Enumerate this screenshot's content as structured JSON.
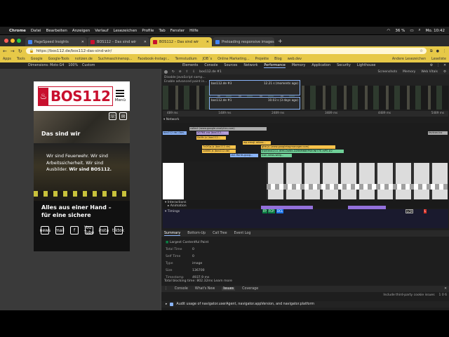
{
  "menubar": {
    "app": "Chrome",
    "items": [
      "Datei",
      "Bearbeiten",
      "Anzeigen",
      "Verlauf",
      "Lesezeichen",
      "Profile",
      "Tab",
      "Fenster",
      "Hilfe"
    ],
    "battery": "36 %",
    "clock": "Mo. 10:42"
  },
  "tabs": [
    {
      "title": "PageSpeed Insights",
      "color": "#4285f4"
    },
    {
      "title": "BOS112 – Das sind wir",
      "color": "#c8102e"
    },
    {
      "title": "BOS112 – Das sind wir",
      "color": "#c8102e"
    },
    {
      "title": "Preloading responsive images",
      "color": "#4285f4"
    }
  ],
  "address": {
    "url": "https://bos112.de/bos112-das-sind-wir/"
  },
  "bookmarks": [
    "Apps",
    "Tools",
    "Google",
    "Google-Tools",
    "notizen.de",
    "Suchmaschinenop...",
    "Facebook-Instagr...",
    "Termstudium",
    "JOB´s",
    "Online Marketing...",
    "Projekte",
    "Blog",
    "web.dev"
  ],
  "bookmarks_right": [
    "Andere Lesezeichen",
    "Leseliste"
  ],
  "devbar": {
    "dimensions": "Dimensions: Moto G4",
    "zoom": "100%",
    "throttle": "Custom",
    "tabs": [
      "Elements",
      "Console",
      "Sources",
      "Network",
      "Performance",
      "Memory",
      "Application",
      "Security",
      "Lighthouse"
    ],
    "active_tab": "Performance"
  },
  "site": {
    "logo": "BOS112",
    "menu_label": "Menü",
    "hero_title": "Das sind wir",
    "intro_plain": "Wir sind Feuerwehr. Wir sind Arbeitssicherheit. Wir sind Ausbilder.",
    "intro_bold": "Wir sind BOS112.",
    "section_title": "Alles aus einer Hand – für eine sichere",
    "social": [
      "news",
      "mail",
      "f",
      "You Tube",
      "insta",
      "tiktok"
    ]
  },
  "perf": {
    "toolbar_host": "bos112.de #1",
    "screenshots": "Screenshots",
    "memory": "Memory",
    "webvitals": "Web Vitals",
    "settings": [
      "Disable JavaScript samp...",
      "Enable advanced paint in..."
    ],
    "popups": [
      {
        "label": "bos112.de #3",
        "meta": "12.21 s (moments ago)"
      },
      {
        "label": "bos112.de #1",
        "meta": "10.03 s (3 days ago)"
      }
    ],
    "ruler": [
      "489 ms",
      "1489 ms",
      "2489 ms",
      "3489 ms",
      "4489 ms",
      "5489 ms"
    ],
    "network_label": "Network",
    "requests": [
      {
        "label": "collect (www.google-analytics.com)",
        "color": "#aaa"
      },
      {
        "label": "bos112.de/ (bos...",
        "color": "#8ab4f8"
      },
      {
        "label": "20764-css (bos112...",
        "color": "#b39ddb"
      },
      {
        "label": "0a4fc.js (bos112...",
        "color": "#f6c34b"
      },
      {
        "label": "wp-emoji-releas...",
        "color": "#f6c34b"
      },
      {
        "label": "gtm.js (www.googletagmanager.com)",
        "color": "#f6c34b"
      },
      {
        "label": "7c0f1a.js (bos112.de)",
        "color": "#f6c34b"
      },
      {
        "label": "trontend2/11 JK96-DaWk-DZ66M68EPSE0NI77E-mP0.#2",
        "color": "#6fcf97"
      },
      {
        "label": "14650.js (bos112.de)",
        "color": "#f6c34b"
      },
      {
        "label": "cb2.ffonts.goog...",
        "color": "#8ab4f8"
      },
      {
        "label": "icon-news-widg...",
        "color": "#6fcf97"
      },
      {
        "label": "favicon.ico",
        "color": "#aaa"
      }
    ],
    "interactions_label": "Interactions",
    "animation_label": "Animation",
    "timings_label": "Timings",
    "timing_tags": [
      "FP",
      "FCP",
      "DCL",
      "LCP",
      "L"
    ],
    "bottom_tabs": [
      "Summary",
      "Bottom-Up",
      "Call Tree",
      "Event Log"
    ],
    "summary": {
      "title": "Largest Contentful Paint",
      "rows": [
        {
          "k": "Total Time",
          "v": "0"
        },
        {
          "k": "Self Time",
          "v": "0"
        },
        {
          "k": "Type",
          "v": "image"
        },
        {
          "k": "Size",
          "v": "136700"
        },
        {
          "k": "Timestamp",
          "v": "4937.9 ms"
        }
      ],
      "tbt": "Total blocking time: 802.32ms",
      "learn": "Learn more"
    },
    "drawer_tabs": [
      "Console",
      "What's New",
      "Issues",
      "Coverage"
    ],
    "drawer_active": "Issues",
    "third_party": "Include third-party cookie issues",
    "counts": "1  0  6",
    "issue_text": "Audit usage of navigator.userAgent, navigator.appVersion, and navigator.platform"
  },
  "colors": {
    "chrome_yellow": "#e7c948",
    "bos_red": "#c8102e"
  }
}
